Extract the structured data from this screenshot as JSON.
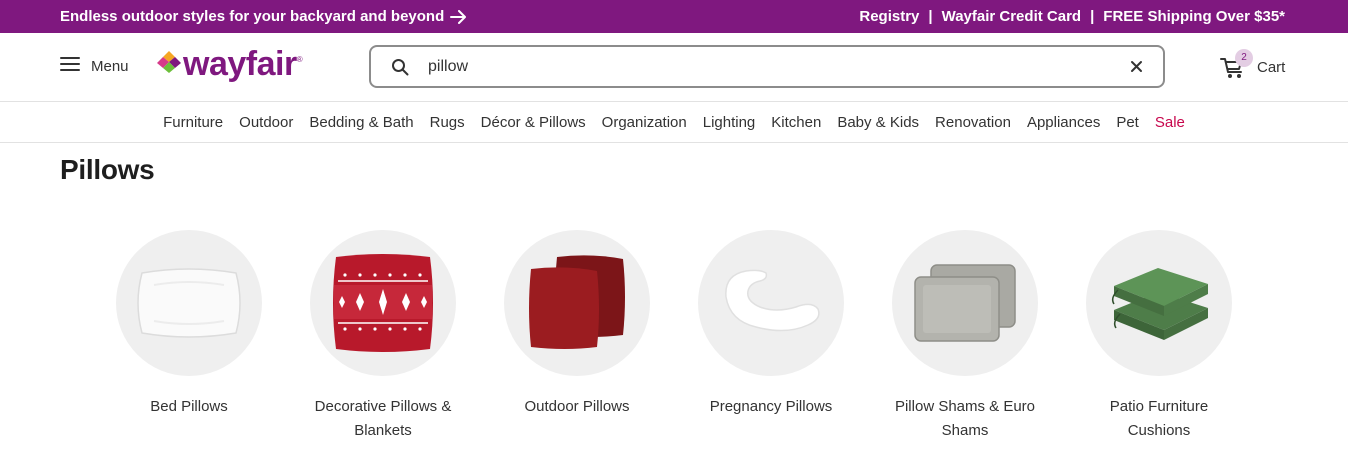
{
  "promo": {
    "left_text": "Endless outdoor styles for your backyard and beyond",
    "links": [
      "Registry",
      "Wayfair Credit Card",
      "FREE Shipping Over $35*"
    ],
    "separator": "|"
  },
  "header": {
    "menu_label": "Menu",
    "logo_text": "wayfair",
    "logo_tm": "®",
    "search_value": "pillow",
    "cart_label": "Cart",
    "cart_count": "2"
  },
  "nav": {
    "items": [
      "Furniture",
      "Outdoor",
      "Bedding & Bath",
      "Rugs",
      "Décor & Pillows",
      "Organization",
      "Lighting",
      "Kitchen",
      "Baby & Kids",
      "Renovation",
      "Appliances",
      "Pet",
      "Sale"
    ]
  },
  "page": {
    "title": "Pillows"
  },
  "categories": [
    {
      "label": "Bed Pillows"
    },
    {
      "label": "Decorative Pillows & Blankets"
    },
    {
      "label": "Outdoor Pillows"
    },
    {
      "label": "Pregnancy Pillows"
    },
    {
      "label": "Pillow Shams & Euro Shams"
    },
    {
      "label": "Patio Furniture Cushions"
    }
  ],
  "colors": {
    "brand": "#7f187f",
    "sale": "#c7074d",
    "tile_bg": "#efefef"
  },
  "icons": [
    "hamburger-icon",
    "search-icon",
    "close-icon",
    "cart-icon",
    "arrow-right-icon"
  ]
}
